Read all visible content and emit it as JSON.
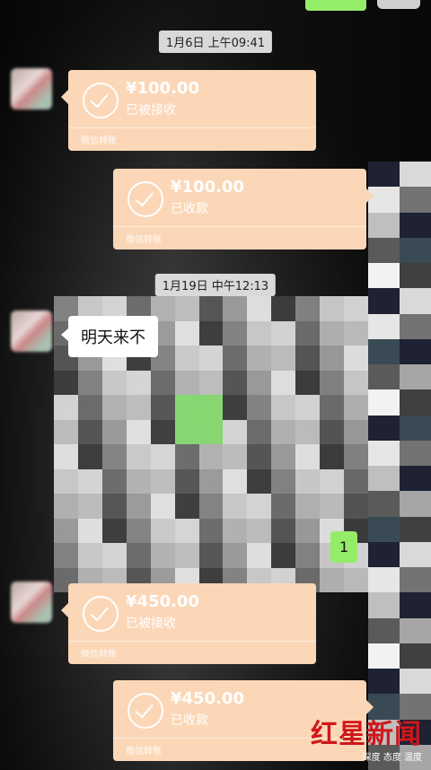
{
  "timestamps": {
    "first": "1月6日 上午09:41",
    "second": "1月19日 中午12:13"
  },
  "transfers": [
    {
      "amount": "¥100.00",
      "status": "已被接收",
      "footer": "微信转账"
    },
    {
      "amount": "¥100.00",
      "status": "已收款",
      "footer": "微信转账"
    },
    {
      "amount": "¥450.00",
      "status": "已被接收",
      "footer": "微信转账"
    },
    {
      "amount": "¥450.00",
      "status": "已收款",
      "footer": "微信转账"
    }
  ],
  "messages": {
    "left_text": "明天来不",
    "right_number": "1"
  },
  "watermark": {
    "brand": "红星新闻",
    "tagline": "深度 态度 温度"
  },
  "colors": {
    "transfer_bg": "#fbd7b7",
    "sent_bubble": "#95ec69",
    "brand_red": "#d0171b"
  }
}
